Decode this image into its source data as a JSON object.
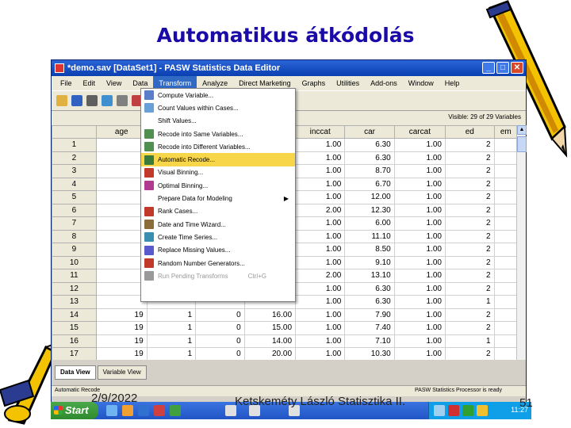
{
  "slide": {
    "title": "Automatikus átkódolás",
    "footer_date": "2/9/2022",
    "footer_author": "Ketskeméty László Statisztika II.",
    "page_number": "51"
  },
  "window": {
    "title": "*demo.sav [DataSet1] - PASW Statistics Data Editor",
    "minimize": "_",
    "maximize": "□",
    "close": "✕"
  },
  "menubar": [
    {
      "label": "File"
    },
    {
      "label": "Edit"
    },
    {
      "label": "View"
    },
    {
      "label": "Data"
    },
    {
      "label": "Transform",
      "active": true
    },
    {
      "label": "Analyze"
    },
    {
      "label": "Direct Marketing"
    },
    {
      "label": "Graphs"
    },
    {
      "label": "Utilities"
    },
    {
      "label": "Add-ons"
    },
    {
      "label": "Window"
    },
    {
      "label": "Help"
    }
  ],
  "toolbar_icons": [
    "open-icon",
    "save-icon",
    "print-icon",
    "dialog-recall-icon",
    "undo-icon",
    "chart-icon",
    "weight-icon",
    "scale-icon",
    "value-labels-icon"
  ],
  "visible_info": "Visible: 29 of 29 Variables",
  "columns": [
    "",
    "age",
    "",
    "",
    "",
    "inccat",
    "car",
    "carcat",
    "ed",
    "em"
  ],
  "rows": [
    {
      "n": "1",
      "age": "",
      "c2": "",
      "c3": "",
      "c4": "",
      "inccat": "1.00",
      "car": "6.30",
      "carcat": "1.00",
      "ed": "2"
    },
    {
      "n": "2",
      "age": "",
      "c2": "",
      "c3": "",
      "c4": "",
      "inccat": "1.00",
      "car": "6.30",
      "carcat": "1.00",
      "ed": "2"
    },
    {
      "n": "3",
      "age": "",
      "c2": "",
      "c3": "",
      "c4": "",
      "inccat": "1.00",
      "car": "8.70",
      "carcat": "1.00",
      "ed": "2"
    },
    {
      "n": "4",
      "age": "",
      "c2": "",
      "c3": "",
      "c4": "",
      "inccat": "1.00",
      "car": "6.70",
      "carcat": "1.00",
      "ed": "2"
    },
    {
      "n": "5",
      "age": "",
      "c2": "",
      "c3": "",
      "c4": "",
      "inccat": "1.00",
      "car": "12.00",
      "carcat": "1.00",
      "ed": "2"
    },
    {
      "n": "6",
      "age": "",
      "c2": "",
      "c3": "",
      "c4": "",
      "inccat": "2.00",
      "car": "12.30",
      "carcat": "1.00",
      "ed": "2"
    },
    {
      "n": "7",
      "age": "",
      "c2": "",
      "c3": "",
      "c4": "",
      "inccat": "1.00",
      "car": "6.00",
      "carcat": "1.00",
      "ed": "2"
    },
    {
      "n": "8",
      "age": "",
      "c2": "",
      "c3": "",
      "c4": "",
      "inccat": "1.00",
      "car": "11.10",
      "carcat": "1.00",
      "ed": "2"
    },
    {
      "n": "9",
      "age": "",
      "c2": "",
      "c3": "",
      "c4": "",
      "inccat": "1.00",
      "car": "8.50",
      "carcat": "1.00",
      "ed": "2"
    },
    {
      "n": "10",
      "age": "",
      "c2": "",
      "c3": "",
      "c4": "",
      "inccat": "1.00",
      "car": "9.10",
      "carcat": "1.00",
      "ed": "2"
    },
    {
      "n": "11",
      "age": "",
      "c2": "",
      "c3": "",
      "c4": "",
      "inccat": "2.00",
      "car": "13.10",
      "carcat": "1.00",
      "ed": "2"
    },
    {
      "n": "12",
      "age": "",
      "c2": "",
      "c3": "",
      "c4": "",
      "inccat": "1.00",
      "car": "6.30",
      "carcat": "1.00",
      "ed": "2"
    },
    {
      "n": "13",
      "age": "",
      "c2": "",
      "c3": "",
      "c4": "",
      "inccat": "1.00",
      "car": "6.30",
      "carcat": "1.00",
      "ed": "1"
    },
    {
      "n": "14",
      "age": "19",
      "c2": "1",
      "c3": "0",
      "c4": "16.00",
      "inccat": "1.00",
      "car": "7.90",
      "carcat": "1.00",
      "ed": "2"
    },
    {
      "n": "15",
      "age": "19",
      "c2": "1",
      "c3": "0",
      "c4": "15.00",
      "inccat": "1.00",
      "car": "7.40",
      "carcat": "1.00",
      "ed": "2"
    },
    {
      "n": "16",
      "age": "19",
      "c2": "1",
      "c3": "0",
      "c4": "14.00",
      "inccat": "1.00",
      "car": "7.10",
      "carcat": "1.00",
      "ed": "1"
    },
    {
      "n": "17",
      "age": "19",
      "c2": "1",
      "c3": "0",
      "c4": "20.00",
      "inccat": "1.00",
      "car": "10.30",
      "carcat": "1.00",
      "ed": "2"
    }
  ],
  "transform_menu": [
    {
      "label": "Compute Variable...",
      "icon": "compute-icon",
      "color": "#5a7fc9"
    },
    {
      "label": "Count Values within Cases...",
      "icon": "count-icon",
      "color": "#6aa0d8"
    },
    {
      "label": "Shift Values...",
      "icon": "",
      "color": ""
    },
    {
      "label": "Recode into Same Variables...",
      "icon": "recode-same-icon",
      "color": "#4f8f4f"
    },
    {
      "label": "Recode into Different Variables...",
      "icon": "recode-different-icon",
      "color": "#4f8f4f"
    },
    {
      "label": "Automatic Recode...",
      "icon": "automatic-recode-icon",
      "color": "#3a7a3a",
      "highlight": true
    },
    {
      "label": "Visual Binning...",
      "icon": "visual-binning-icon",
      "color": "#c0392b"
    },
    {
      "label": "Optimal Binning...",
      "icon": "optimal-binning-icon",
      "color": "#b03a8f"
    },
    {
      "label": "Prepare Data for Modeling",
      "icon": "",
      "color": "",
      "submenu": true
    },
    {
      "label": "Rank Cases...",
      "icon": "rank-cases-icon",
      "color": "#c0392b"
    },
    {
      "label": "Date and Time Wizard...",
      "icon": "date-time-icon",
      "color": "#8a6d3b"
    },
    {
      "label": "Create Time Series...",
      "icon": "time-series-icon",
      "color": "#3a8fb0"
    },
    {
      "label": "Replace Missing Values...",
      "icon": "replace-missing-icon",
      "color": "#5a5acf"
    },
    {
      "label": "Random Number Generators...",
      "icon": "random-number-icon",
      "color": "#c0392b"
    },
    {
      "label": "Run Pending Transforms",
      "icon": "run-pending-icon",
      "color": "#999999",
      "shortcut": "Ctrl+G",
      "disabled": true
    }
  ],
  "tabs": [
    {
      "label": "Data View",
      "active": true
    },
    {
      "label": "Variable View"
    }
  ],
  "status": {
    "left": "Automatic Recode",
    "right": "PASW Statistics Processor is ready"
  },
  "taskbar": {
    "start": "Start",
    "clock": "11:27"
  }
}
